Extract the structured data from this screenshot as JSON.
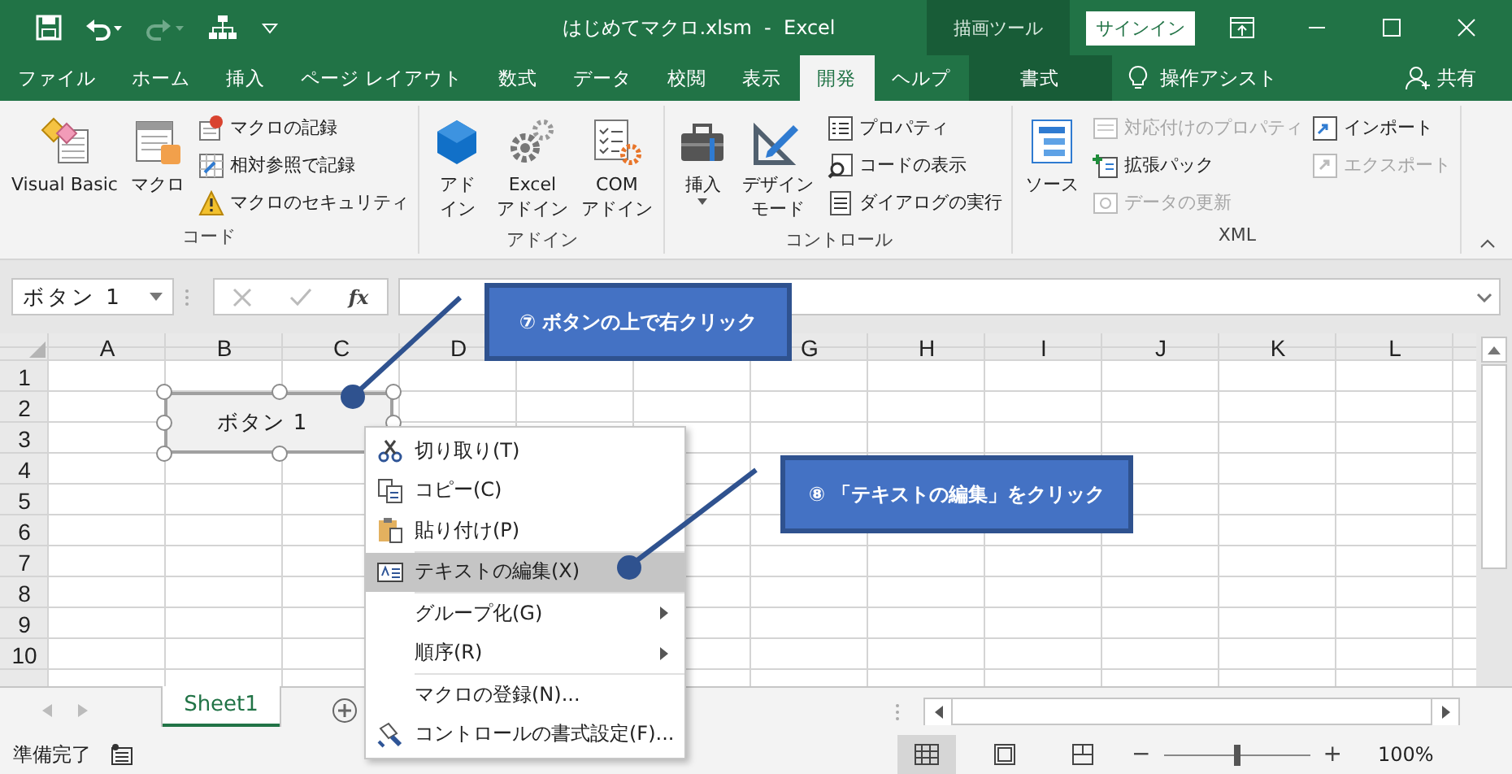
{
  "title_bar": {
    "title": "はじめてマクロ.xlsm  -  Excel",
    "context_label": "描画ツール",
    "sign_in": "サインイン"
  },
  "ribbon_tabs": [
    {
      "label": "ファイル",
      "selected": false,
      "kind": "normal"
    },
    {
      "label": "ホーム",
      "selected": false,
      "kind": "normal"
    },
    {
      "label": "挿入",
      "selected": false,
      "kind": "normal"
    },
    {
      "label": "ページ レイアウト",
      "selected": false,
      "kind": "normal"
    },
    {
      "label": "数式",
      "selected": false,
      "kind": "normal"
    },
    {
      "label": "データ",
      "selected": false,
      "kind": "normal"
    },
    {
      "label": "校閲",
      "selected": false,
      "kind": "normal"
    },
    {
      "label": "表示",
      "selected": false,
      "kind": "normal"
    },
    {
      "label": "開発",
      "selected": true,
      "kind": "normal"
    },
    {
      "label": "ヘルプ",
      "selected": false,
      "kind": "normal"
    },
    {
      "label": "書式",
      "selected": false,
      "kind": "contextual"
    }
  ],
  "tell_me": "操作アシスト",
  "share": "共有",
  "ribbon_groups": [
    {
      "label": "コード",
      "large": [
        {
          "lines": [
            "Visual Basic"
          ],
          "dropdown": false
        },
        {
          "lines": [
            "マクロ"
          ],
          "dropdown": false
        }
      ],
      "small": [
        {
          "label": "マクロの記録",
          "disabled": false
        },
        {
          "label": "相対参照で記録",
          "disabled": false
        },
        {
          "label": "マクロのセキュリティ",
          "disabled": false
        }
      ]
    },
    {
      "label": "アドイン",
      "large": [
        {
          "lines": [
            "アド",
            "イン"
          ],
          "dropdown": false
        },
        {
          "lines": [
            "Excel",
            "アドイン"
          ],
          "dropdown": false
        },
        {
          "lines": [
            "COM",
            "アドイン"
          ],
          "dropdown": false
        }
      ]
    },
    {
      "label": "コントロール",
      "large": [
        {
          "lines": [
            "挿入"
          ],
          "dropdown": true
        },
        {
          "lines": [
            "デザイン",
            "モード"
          ],
          "dropdown": false
        }
      ],
      "small": [
        {
          "label": "プロパティ",
          "disabled": false
        },
        {
          "label": "コードの表示",
          "disabled": false
        },
        {
          "label": "ダイアログの実行",
          "disabled": false
        }
      ]
    },
    {
      "label": "XML",
      "large": [
        {
          "lines": [
            "ソース"
          ],
          "dropdown": false
        }
      ],
      "small": [
        {
          "label": "対応付けのプロパティ",
          "disabled": true
        },
        {
          "label": "拡張パック",
          "disabled": false
        },
        {
          "label": "データの更新",
          "disabled": true
        },
        {
          "label": "インポート",
          "disabled": false
        },
        {
          "label": "エクスポート",
          "disabled": true
        }
      ]
    }
  ],
  "formula_bar": {
    "name_box": "ボタン 1",
    "function_button": "fx"
  },
  "sheet": {
    "columns": [
      "A",
      "B",
      "C",
      "D",
      "G",
      "H",
      "I",
      "J",
      "K",
      "L"
    ],
    "rows": [
      "1",
      "2",
      "3",
      "4",
      "5",
      "6",
      "7",
      "8",
      "9",
      "10"
    ],
    "shape": {
      "label": "ボタン 1"
    },
    "context_menu": [
      {
        "label": "切り取り(T)",
        "kind": "cut",
        "selected": false,
        "submenu": false,
        "divider_above": false
      },
      {
        "label": "コピー(C)",
        "kind": "copy",
        "selected": false,
        "submenu": false,
        "divider_above": false
      },
      {
        "label": "貼り付け(P)",
        "kind": "paste",
        "selected": false,
        "submenu": false,
        "divider_above": false
      },
      {
        "label": "テキストの編集(X)",
        "kind": "edit-text",
        "selected": true,
        "submenu": false,
        "divider_above": true
      },
      {
        "label": "グループ化(G)",
        "kind": "plain",
        "selected": false,
        "submenu": true,
        "divider_above": true
      },
      {
        "label": "順序(R)",
        "kind": "plain",
        "selected": false,
        "submenu": true,
        "divider_above": false
      },
      {
        "label": "マクロの登録(N)...",
        "kind": "plain",
        "selected": false,
        "submenu": false,
        "divider_above": true
      },
      {
        "label": "コントロールの書式設定(F)...",
        "kind": "format",
        "selected": false,
        "submenu": false,
        "divider_above": false
      }
    ],
    "callouts": [
      {
        "text": "⑦ ボタンの上で右クリック"
      },
      {
        "text": "⑧ 「テキストの編集」をクリック"
      }
    ]
  },
  "sheet_tabs": [
    {
      "label": "Sheet1",
      "selected": true
    }
  ],
  "status_bar": {
    "text": "準備完了",
    "view_buttons": [
      {
        "selected": true
      },
      {
        "selected": false
      },
      {
        "selected": false
      }
    ],
    "zoom_out": "−",
    "zoom_in": "+",
    "zoom": {
      "level": 0.5,
      "reading": "100%"
    }
  }
}
